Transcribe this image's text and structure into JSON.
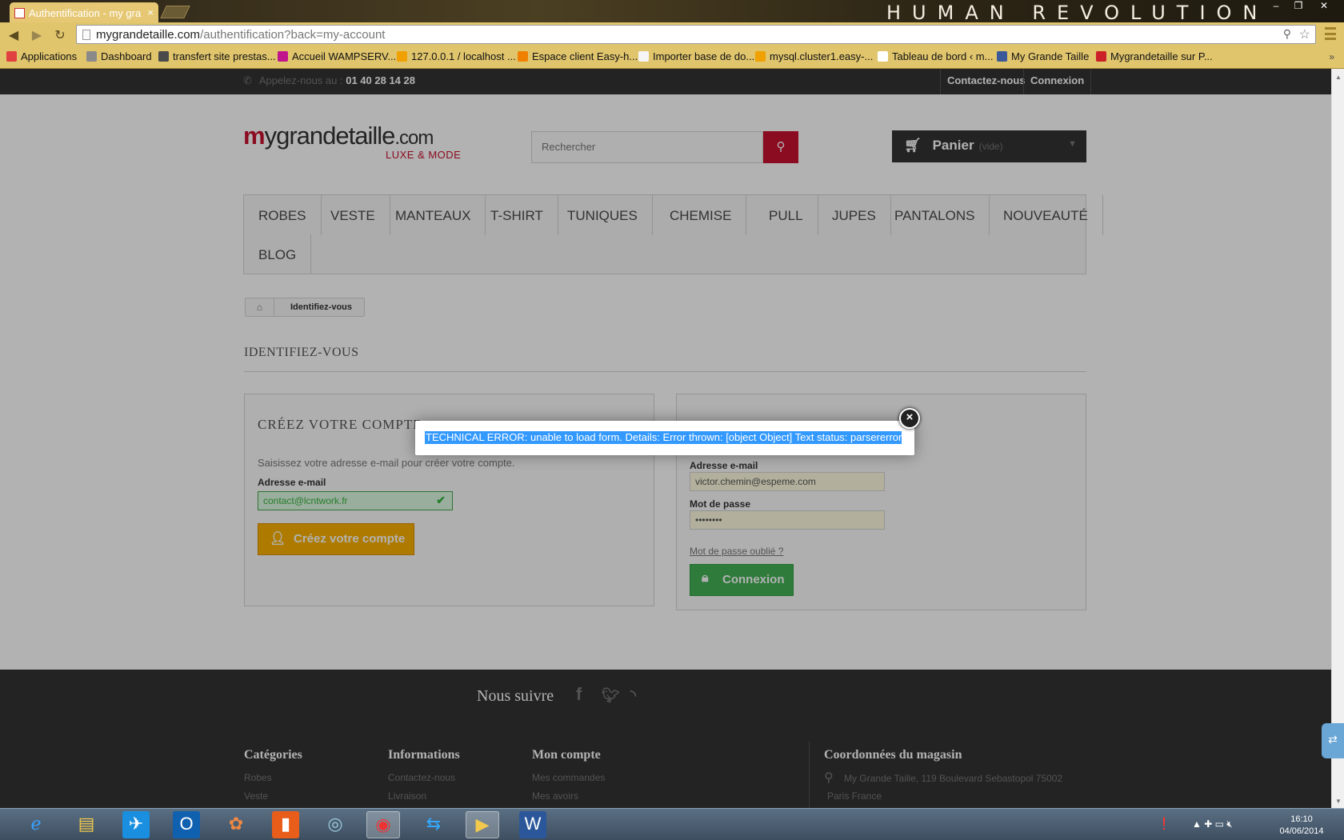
{
  "browser": {
    "tab_title": "Authentification - my gra",
    "tab_close": "×",
    "brand_text": "HUMAN REVOLUTION",
    "url_host": "mygrandetaille.com",
    "url_path": "/authentification?back=my-account",
    "min": "–",
    "max": "❐",
    "close": "✕",
    "back": "◀",
    "forward": "▶",
    "reload": "↻"
  },
  "bookmarks": [
    {
      "label": "Applications",
      "color": "#e04040"
    },
    {
      "label": "Dashboard",
      "color": "#8a8a8a"
    },
    {
      "label": "transfert site prestas...",
      "color": "#4a4a4a"
    },
    {
      "label": "Accueil WAMPSERV...",
      "color": "#c0148c"
    },
    {
      "label": "127.0.0.1 / localhost ...",
      "color": "#f0a000"
    },
    {
      "label": "Espace client Easy-h...",
      "color": "#f08000"
    },
    {
      "label": "Importer base de do...",
      "color": "#f5f5f5"
    },
    {
      "label": "mysql.cluster1.easy-...",
      "color": "#f0a000"
    },
    {
      "label": "Tableau de bord ‹ m...",
      "color": "#ffffff"
    },
    {
      "label": "My Grande Taille",
      "color": "#3b5998"
    },
    {
      "label": "Mygrandetaille sur P...",
      "color": "#cb2027"
    }
  ],
  "bookmarks_more": "»",
  "site": {
    "phone_label": "Appelez-nous au :",
    "phone_number": "01 40 28 14 28",
    "contact_link": "Contactez-nous",
    "login_link": "Connexion",
    "logo_m": "m",
    "logo_rest": "ygrandetaille",
    "logo_tld": ".com",
    "logo_sub": "LUXE & MODE",
    "search_placeholder": "Rechercher",
    "cart_label": "Panier",
    "cart_state": "(vide)",
    "menu": [
      "ROBES",
      "VESTE",
      "MANTEAUX",
      "T-SHIRT",
      "TUNIQUES",
      "CHEMISE",
      "PULL",
      "JUPES",
      "PANTALONS",
      "NOUVEAUTÉ",
      "BLOG"
    ],
    "breadcrumb": "Identifiez-vous",
    "page_title": "IDENTIFIEZ-VOUS"
  },
  "create_account": {
    "title": "CRÉEZ VOTRE COMPTE",
    "description": "Saisissez votre adresse e-mail pour créer votre compte.",
    "email_label": "Adresse e-mail",
    "email_value": "contact@lcntwork.fr",
    "button": "Créez votre compte"
  },
  "login": {
    "email_label": "Adresse e-mail",
    "email_value": "victor.chemin@espeme.com",
    "password_label": "Mot de passe",
    "password_value": "••••••••",
    "forgot": "Mot de passe oublié ?",
    "button": "Connexion"
  },
  "modal": {
    "message": "TECHNICAL ERROR: unable to load form. Details: Error thrown: [object Object] Text status: parsererror",
    "close": "×"
  },
  "footer": {
    "follow": "Nous suivre",
    "categories_title": "Catégories",
    "categories": [
      "Robes",
      "Veste"
    ],
    "info_title": "Informations",
    "info": [
      "Contactez-nous",
      "Livraison"
    ],
    "account_title": "Mon compte",
    "account": [
      "Mes commandes",
      "Mes avoirs"
    ],
    "store_title": "Coordonnées du magasin",
    "address_line1": "My Grande Taille, 119 Boulevard Sebastopol 75002",
    "address_line2": "Paris France"
  },
  "taskbar": {
    "time": "16:10",
    "date": "04/06/2014"
  }
}
